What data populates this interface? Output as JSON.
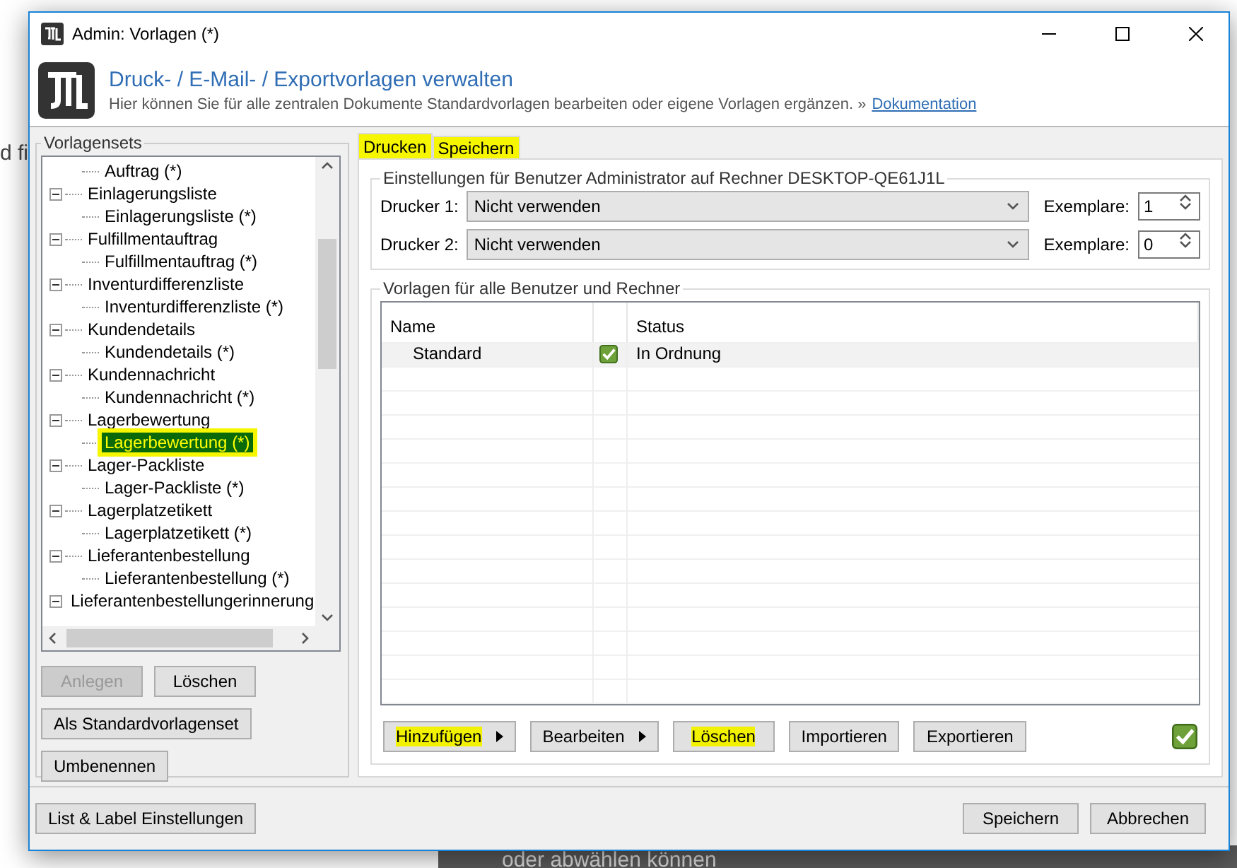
{
  "background_texts": [
    {
      "text": "d fi"
    },
    {
      "text": "oder abwählen können"
    }
  ],
  "window": {
    "title": "Admin: Vorlagen (*)"
  },
  "header": {
    "title": "Druck- / E-Mail- / Exportvorlagen verwalten",
    "description": "Hier können Sie für alle zentralen Dokumente Standardvorlagen bearbeiten oder eigene Vorlagen ergänzen. »",
    "link": "Dokumentation"
  },
  "vorlagensets": {
    "title": "Vorlagensets",
    "tree": [
      {
        "children": [
          {
            "label": "Auftrag (*)",
            "selected": false,
            "highlighted": false
          }
        ]
      },
      {
        "label": "Einlagerungsliste",
        "expanded": true,
        "children": [
          {
            "label": "Einlagerungsliste (*)",
            "selected": false,
            "highlighted": false
          }
        ]
      },
      {
        "label": "Fulfillmentauftrag",
        "expanded": true,
        "children": [
          {
            "label": "Fulfillmentauftrag (*)",
            "selected": false,
            "highlighted": false
          }
        ]
      },
      {
        "label": "Inventurdifferenzliste",
        "expanded": true,
        "children": [
          {
            "label": "Inventurdifferenzliste (*)",
            "selected": false,
            "highlighted": false
          }
        ]
      },
      {
        "label": "Kundendetails",
        "expanded": true,
        "children": [
          {
            "label": "Kundendetails (*)",
            "selected": false,
            "highlighted": false
          }
        ]
      },
      {
        "label": "Kundennachricht",
        "expanded": true,
        "children": [
          {
            "label": "Kundennachricht (*)",
            "selected": false,
            "highlighted": false
          }
        ]
      },
      {
        "label": "Lagerbewertung",
        "expanded": true,
        "children": [
          {
            "label": "Lagerbewertung (*)",
            "selected": true,
            "highlighted": true
          }
        ]
      },
      {
        "label": "Lager-Packliste",
        "expanded": true,
        "children": [
          {
            "label": "Lager-Packliste (*)",
            "selected": false,
            "highlighted": false
          }
        ]
      },
      {
        "label": "Lagerplatzetikett",
        "expanded": true,
        "children": [
          {
            "label": "Lagerplatzetikett (*)",
            "selected": false,
            "highlighted": false
          }
        ]
      },
      {
        "label": "Lieferantenbestellung",
        "expanded": true,
        "children": [
          {
            "label": "Lieferantenbestellung (*)",
            "selected": false,
            "highlighted": false
          }
        ]
      },
      {
        "label": "Lieferantenbestellungerinnerung",
        "expanded": true
      }
    ],
    "buttons": [
      {
        "label": "Anlegen",
        "disabled": true
      },
      {
        "label": "Löschen",
        "disabled": false
      },
      {
        "label": "Als Standardvorlagenset",
        "disabled": false
      },
      {
        "label": "Umbenennen",
        "disabled": false
      }
    ]
  },
  "tabs": [
    {
      "label": "Drucken",
      "selected": true,
      "highlighted": true
    },
    {
      "label": "Speichern",
      "selected": false,
      "highlighted": true
    }
  ],
  "user_settings": {
    "title": "Einstellungen für Benutzer Administrator auf Rechner DESKTOP-QE61J1L",
    "printers": [
      {
        "label": "Drucker 1:",
        "value": "Nicht verwenden",
        "copies_label": "Exemplare:",
        "copies": "1"
      },
      {
        "label": "Drucker 2:",
        "value": "Nicht verwenden",
        "copies_label": "Exemplare:",
        "copies": "0"
      }
    ]
  },
  "templates": {
    "title": "Vorlagen für alle Benutzer und Rechner",
    "columns": [
      "Name",
      "Status"
    ],
    "rows": [
      {
        "name": "Standard",
        "ok": true,
        "status": "In Ordnung",
        "selected": true
      }
    ],
    "buttons": [
      {
        "label": "Hinzufügen",
        "kind": "menu",
        "highlighted": true
      },
      {
        "label": "Bearbeiten",
        "kind": "menu",
        "highlighted": false
      },
      {
        "label": "Löschen",
        "kind": "plain",
        "highlighted": true
      },
      {
        "label": "Importieren",
        "kind": "plain",
        "highlighted": false
      },
      {
        "label": "Exportieren",
        "kind": "plain",
        "highlighted": false
      }
    ],
    "all_ok": true
  },
  "footer": {
    "left_button": "List & Label Einstellungen",
    "buttons": [
      "Speichern",
      "Abbrechen"
    ]
  }
}
